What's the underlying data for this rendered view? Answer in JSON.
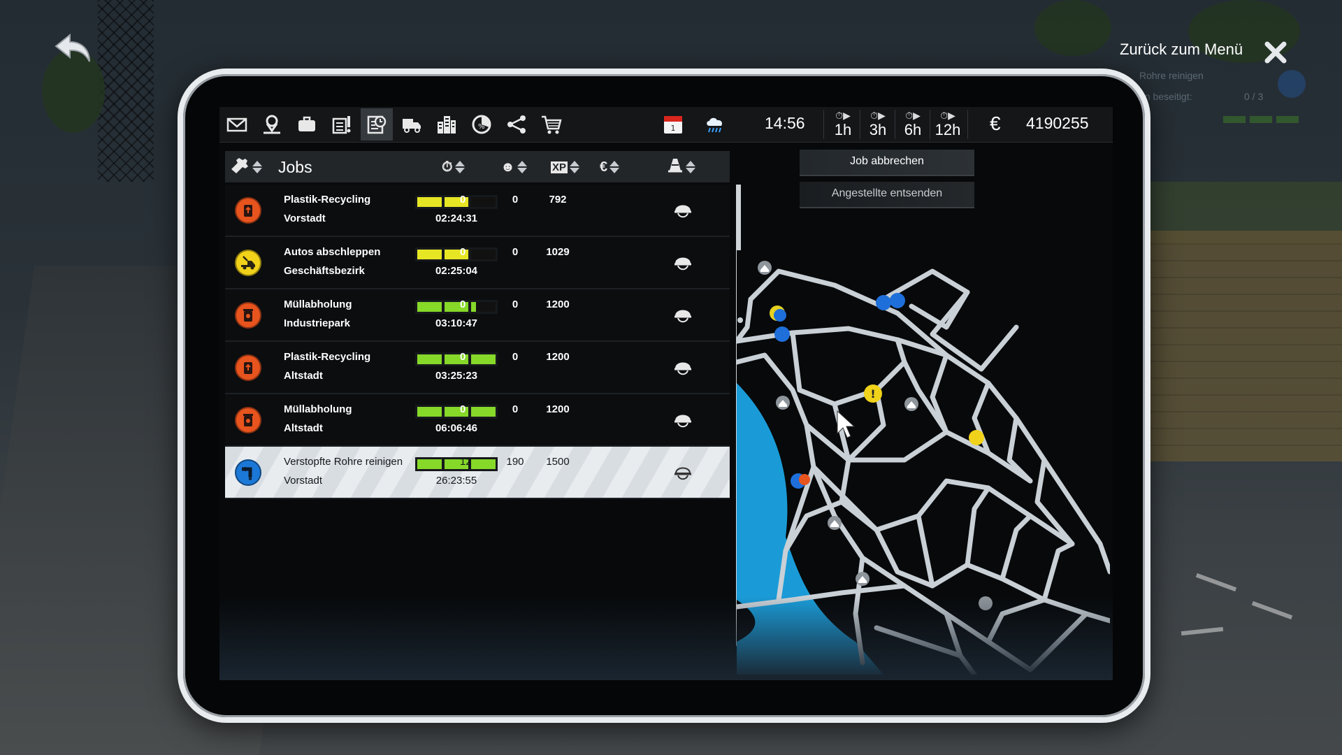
{
  "hud": {
    "back_menu_label": "Zurück zum Menü",
    "ghost_task_title": "Rohre reinigen",
    "ghost_task_line": "en beseitigt:",
    "ghost_task_progress": "0 / 3"
  },
  "toolbar": {
    "calendar_day": "1",
    "clock": "14:56",
    "speeds": [
      "1h",
      "3h",
      "6h",
      "12h"
    ],
    "currency_symbol": "€",
    "money": "4190255"
  },
  "jobs": {
    "title": "Jobs",
    "header_icons": {
      "xp": "XP",
      "money": "€"
    },
    "rows": [
      {
        "name": "Plastik-Recycling",
        "district": "Vorstadt",
        "time": "02:24:31",
        "progress_filled": 2,
        "progress_color": "#e7e624",
        "happy": "0",
        "xp": "0",
        "money": "792",
        "icon": "recycling-icon",
        "badge_color": "#e8541e",
        "selected": false
      },
      {
        "name": "Autos abschleppen",
        "district": "Geschäftsbezirk",
        "time": "02:25:04",
        "progress_filled": 2,
        "progress_color": "#e7e624",
        "happy": "0",
        "xp": "0",
        "money": "1029",
        "icon": "tow-truck-icon",
        "badge_color": "#f1d21a",
        "selected": false
      },
      {
        "name": "Müllabholung",
        "district": "Industriepark",
        "time": "03:10:47",
        "progress_filled": 2.2,
        "progress_color": "#86d829",
        "happy": "0",
        "xp": "0",
        "money": "1200",
        "icon": "garbage-icon",
        "badge_color": "#e8541e",
        "selected": false
      },
      {
        "name": "Plastik-Recycling",
        "district": "Altstadt",
        "time": "03:25:23",
        "progress_filled": 3,
        "progress_color": "#86d829",
        "happy": "0",
        "xp": "0",
        "money": "1200",
        "icon": "recycling-icon",
        "badge_color": "#e8541e",
        "selected": false
      },
      {
        "name": "Müllabholung",
        "district": "Altstadt",
        "time": "06:06:46",
        "progress_filled": 3,
        "progress_color": "#86d829",
        "happy": "0",
        "xp": "0",
        "money": "1200",
        "icon": "garbage-icon",
        "badge_color": "#e8541e",
        "selected": false
      },
      {
        "name": "Verstopfte Rohre reinigen",
        "district": "Vorstadt",
        "time": "26:23:55",
        "progress_filled": 3,
        "progress_color": "#86d829",
        "happy": "12",
        "xp": "190",
        "money": "1500",
        "icon": "pipe-icon",
        "badge_color": "#1c78d6",
        "selected": true
      }
    ]
  },
  "actions": {
    "cancel_job": "Job abbrechen",
    "send_employees": "Angestellte entsenden"
  },
  "colors": {
    "accent_green": "#86d829",
    "accent_yellow": "#e7e624",
    "water": "#1a9bd7",
    "road": "#c9d0d6",
    "marker_blue": "#1e6fd9"
  }
}
